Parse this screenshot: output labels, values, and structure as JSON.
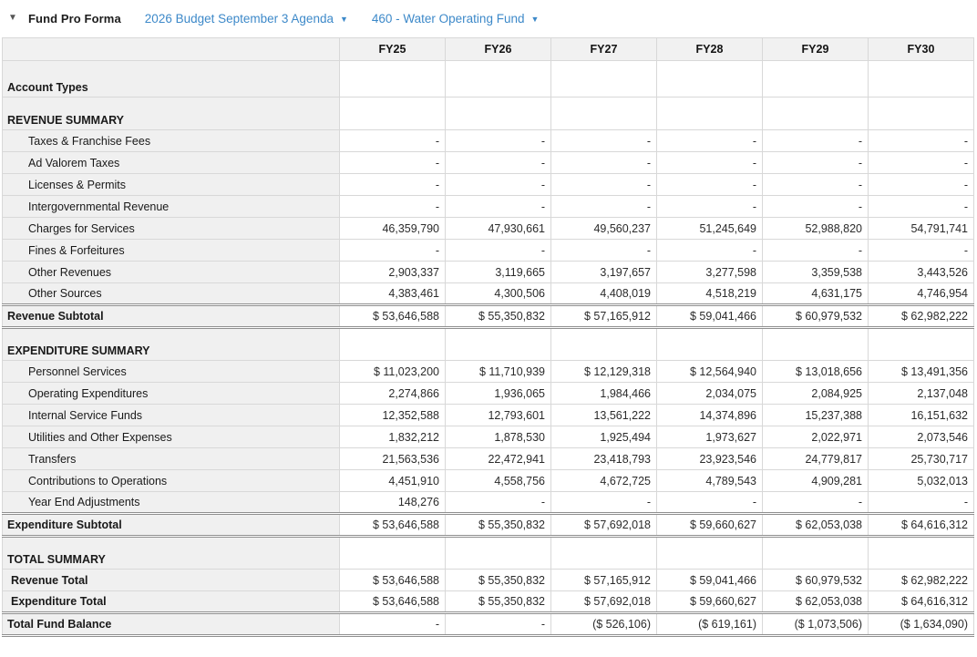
{
  "header": {
    "collapse_caret": "▼",
    "title": "Fund Pro Forma",
    "budget_selector": "2026 Budget September 3 Agenda",
    "fund_selector": "460 - Water Operating Fund",
    "selector_caret": "▼"
  },
  "colors": {
    "link_blue": "#3d89c9",
    "label_column_bg": "#f0f0f0",
    "header_row_bg": "#f1f1f1",
    "gridline": "#d8d8d8",
    "emphasis_border": "#8f8f8f"
  },
  "table": {
    "columns": [
      "FY25",
      "FY26",
      "FY27",
      "FY28",
      "FY29",
      "FY30"
    ],
    "rows": [
      {
        "type": "section-xl",
        "label": "Account Types",
        "values": [
          "",
          "",
          "",
          "",
          "",
          ""
        ]
      },
      {
        "type": "section",
        "label": "REVENUE SUMMARY",
        "values": [
          "",
          "",
          "",
          "",
          "",
          ""
        ]
      },
      {
        "type": "item",
        "label": "Taxes & Franchise Fees",
        "values": [
          "-",
          "-",
          "-",
          "-",
          "-",
          "-"
        ]
      },
      {
        "type": "item",
        "label": "Ad Valorem Taxes",
        "values": [
          "-",
          "-",
          "-",
          "-",
          "-",
          "-"
        ]
      },
      {
        "type": "item",
        "label": "Licenses & Permits",
        "values": [
          "-",
          "-",
          "-",
          "-",
          "-",
          "-"
        ]
      },
      {
        "type": "item",
        "label": "Intergovernmental Revenue",
        "values": [
          "-",
          "-",
          "-",
          "-",
          "-",
          "-"
        ]
      },
      {
        "type": "item",
        "label": "Charges for Services",
        "values": [
          "46,359,790",
          "47,930,661",
          "49,560,237",
          "51,245,649",
          "52,988,820",
          "54,791,741"
        ]
      },
      {
        "type": "item",
        "label": "Fines & Forfeitures",
        "values": [
          "-",
          "-",
          "-",
          "-",
          "-",
          "-"
        ]
      },
      {
        "type": "item",
        "label": "Other Revenues",
        "values": [
          "2,903,337",
          "3,119,665",
          "3,197,657",
          "3,277,598",
          "3,359,538",
          "3,443,526"
        ]
      },
      {
        "type": "item",
        "label": "Other Sources",
        "values": [
          "4,383,461",
          "4,300,506",
          "4,408,019",
          "4,518,219",
          "4,631,175",
          "4,746,954"
        ]
      },
      {
        "type": "subtotal",
        "label": "Revenue Subtotal",
        "values": [
          "$ 53,646,588",
          "$ 55,350,832",
          "$ 57,165,912",
          "$ 59,041,466",
          "$ 60,979,532",
          "$ 62,982,222"
        ]
      },
      {
        "type": "section",
        "label": "EXPENDITURE SUMMARY",
        "values": [
          "",
          "",
          "",
          "",
          "",
          ""
        ]
      },
      {
        "type": "item",
        "label": "Personnel Services",
        "values": [
          "$ 11,023,200",
          "$ 11,710,939",
          "$ 12,129,318",
          "$ 12,564,940",
          "$ 13,018,656",
          "$ 13,491,356"
        ]
      },
      {
        "type": "item",
        "label": "Operating Expenditures",
        "values": [
          "2,274,866",
          "1,936,065",
          "1,984,466",
          "2,034,075",
          "2,084,925",
          "2,137,048"
        ]
      },
      {
        "type": "item",
        "label": "Internal Service Funds",
        "values": [
          "12,352,588",
          "12,793,601",
          "13,561,222",
          "14,374,896",
          "15,237,388",
          "16,151,632"
        ]
      },
      {
        "type": "item",
        "label": "Utilities and Other Expenses",
        "values": [
          "1,832,212",
          "1,878,530",
          "1,925,494",
          "1,973,627",
          "2,022,971",
          "2,073,546"
        ]
      },
      {
        "type": "item",
        "label": "Transfers",
        "values": [
          "21,563,536",
          "22,472,941",
          "23,418,793",
          "23,923,546",
          "24,779,817",
          "25,730,717"
        ]
      },
      {
        "type": "item",
        "label": "Contributions to Operations",
        "values": [
          "4,451,910",
          "4,558,756",
          "4,672,725",
          "4,789,543",
          "4,909,281",
          "5,032,013"
        ]
      },
      {
        "type": "item",
        "label": "Year End Adjustments",
        "values": [
          "148,276",
          "-",
          "-",
          "-",
          "-",
          "-"
        ]
      },
      {
        "type": "subtotal",
        "label": "Expenditure Subtotal",
        "values": [
          "$ 53,646,588",
          "$ 55,350,832",
          "$ 57,692,018",
          "$ 59,660,627",
          "$ 62,053,038",
          "$ 64,616,312"
        ]
      },
      {
        "type": "section",
        "label": "TOTAL SUMMARY",
        "values": [
          "",
          "",
          "",
          "",
          "",
          ""
        ]
      },
      {
        "type": "total",
        "label": "Revenue Total",
        "values": [
          "$ 53,646,588",
          "$ 55,350,832",
          "$ 57,165,912",
          "$ 59,041,466",
          "$ 60,979,532",
          "$ 62,982,222"
        ]
      },
      {
        "type": "total",
        "label": "Expenditure Total",
        "values": [
          "$ 53,646,588",
          "$ 55,350,832",
          "$ 57,692,018",
          "$ 59,660,627",
          "$ 62,053,038",
          "$ 64,616,312"
        ]
      },
      {
        "type": "balance",
        "label": "Total Fund Balance",
        "values": [
          "-",
          "-",
          "($ 526,106)",
          "($ 619,161)",
          "($ 1,073,506)",
          "($ 1,634,090)"
        ]
      }
    ]
  }
}
